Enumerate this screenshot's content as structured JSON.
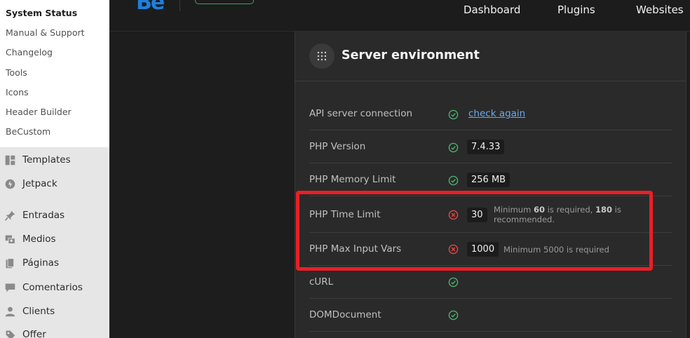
{
  "sidebar": {
    "submenu": [
      {
        "label": "System Status",
        "current": true
      },
      {
        "label": "Manual & Support"
      },
      {
        "label": "Changelog"
      },
      {
        "label": "Tools"
      },
      {
        "label": "Icons"
      },
      {
        "label": "Header Builder"
      },
      {
        "label": "BeCustom"
      }
    ],
    "menu": [
      {
        "label": "Templates",
        "icon": "templates-icon"
      },
      {
        "label": "Jetpack",
        "icon": "jetpack-icon"
      },
      {
        "label": "Entradas",
        "icon": "pin-icon"
      },
      {
        "label": "Medios",
        "icon": "media-icon"
      },
      {
        "label": "Páginas",
        "icon": "pages-icon"
      },
      {
        "label": "Comentarios",
        "icon": "comments-icon"
      },
      {
        "label": "Clients",
        "icon": "clients-icon"
      },
      {
        "label": "Offer",
        "icon": "offer-icon"
      }
    ]
  },
  "topbar": {
    "logo": "Be",
    "nav": [
      "Dashboard",
      "Plugins",
      "Websites"
    ]
  },
  "panel": {
    "title": "Server environment",
    "rows": [
      {
        "label": "API server connection",
        "status": "ok",
        "link": "check again"
      },
      {
        "label": "PHP Version",
        "status": "ok",
        "value": "7.4.33"
      },
      {
        "label": "PHP Memory Limit",
        "status": "ok",
        "value": "256 MB"
      },
      {
        "label": "PHP Time Limit",
        "status": "error",
        "value": "30",
        "note": {
          "pre": "Minimum ",
          "min": "60",
          "mid": " is required, ",
          "rec": "180",
          "post": " is",
          "line2": "recommended."
        }
      },
      {
        "label": "PHP Max Input Vars",
        "status": "error",
        "value": "1000",
        "note_text": "Minimum 5000 is required"
      },
      {
        "label": "cURL",
        "status": "ok"
      },
      {
        "label": "DOMDocument",
        "status": "ok"
      }
    ]
  },
  "colors": {
    "ok": "#4caf6e",
    "error": "#e04646",
    "highlight": "#ea1f25",
    "link": "#6aa9ee"
  }
}
